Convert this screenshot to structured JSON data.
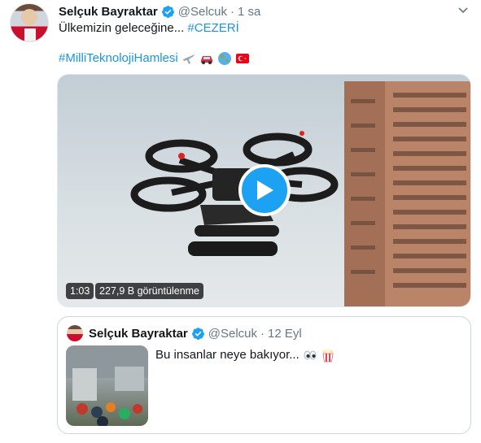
{
  "tweet": {
    "author_name": "Selçuk Bayraktar",
    "handle": "@Selcuk",
    "separator": "·",
    "time": "1 sa",
    "text_line1": "Ülkemizin geleceğine... ",
    "hashtag1": "#CEZERİ",
    "hashtag2": "#MilliTeknolojiHamlesi",
    "emojis": [
      "airplane-emoji",
      "car-emoji",
      "globe-emoji",
      "turkey-flag-emoji"
    ]
  },
  "video": {
    "duration": "1:03",
    "views": "227,9 B görüntülenme",
    "play_color": "#1da1f2"
  },
  "quoted_tweet": {
    "author_name": "Selçuk Bayraktar",
    "handle": "@Selcuk",
    "separator": "·",
    "time": "12 Eyl",
    "text": "Bu insanlar neye bakıyor... ",
    "emojis": [
      "eyes-emoji",
      "popcorn-emoji"
    ]
  },
  "colors": {
    "link": "#1b95e0",
    "verified": "#1da1f2",
    "muted": "#657786"
  }
}
